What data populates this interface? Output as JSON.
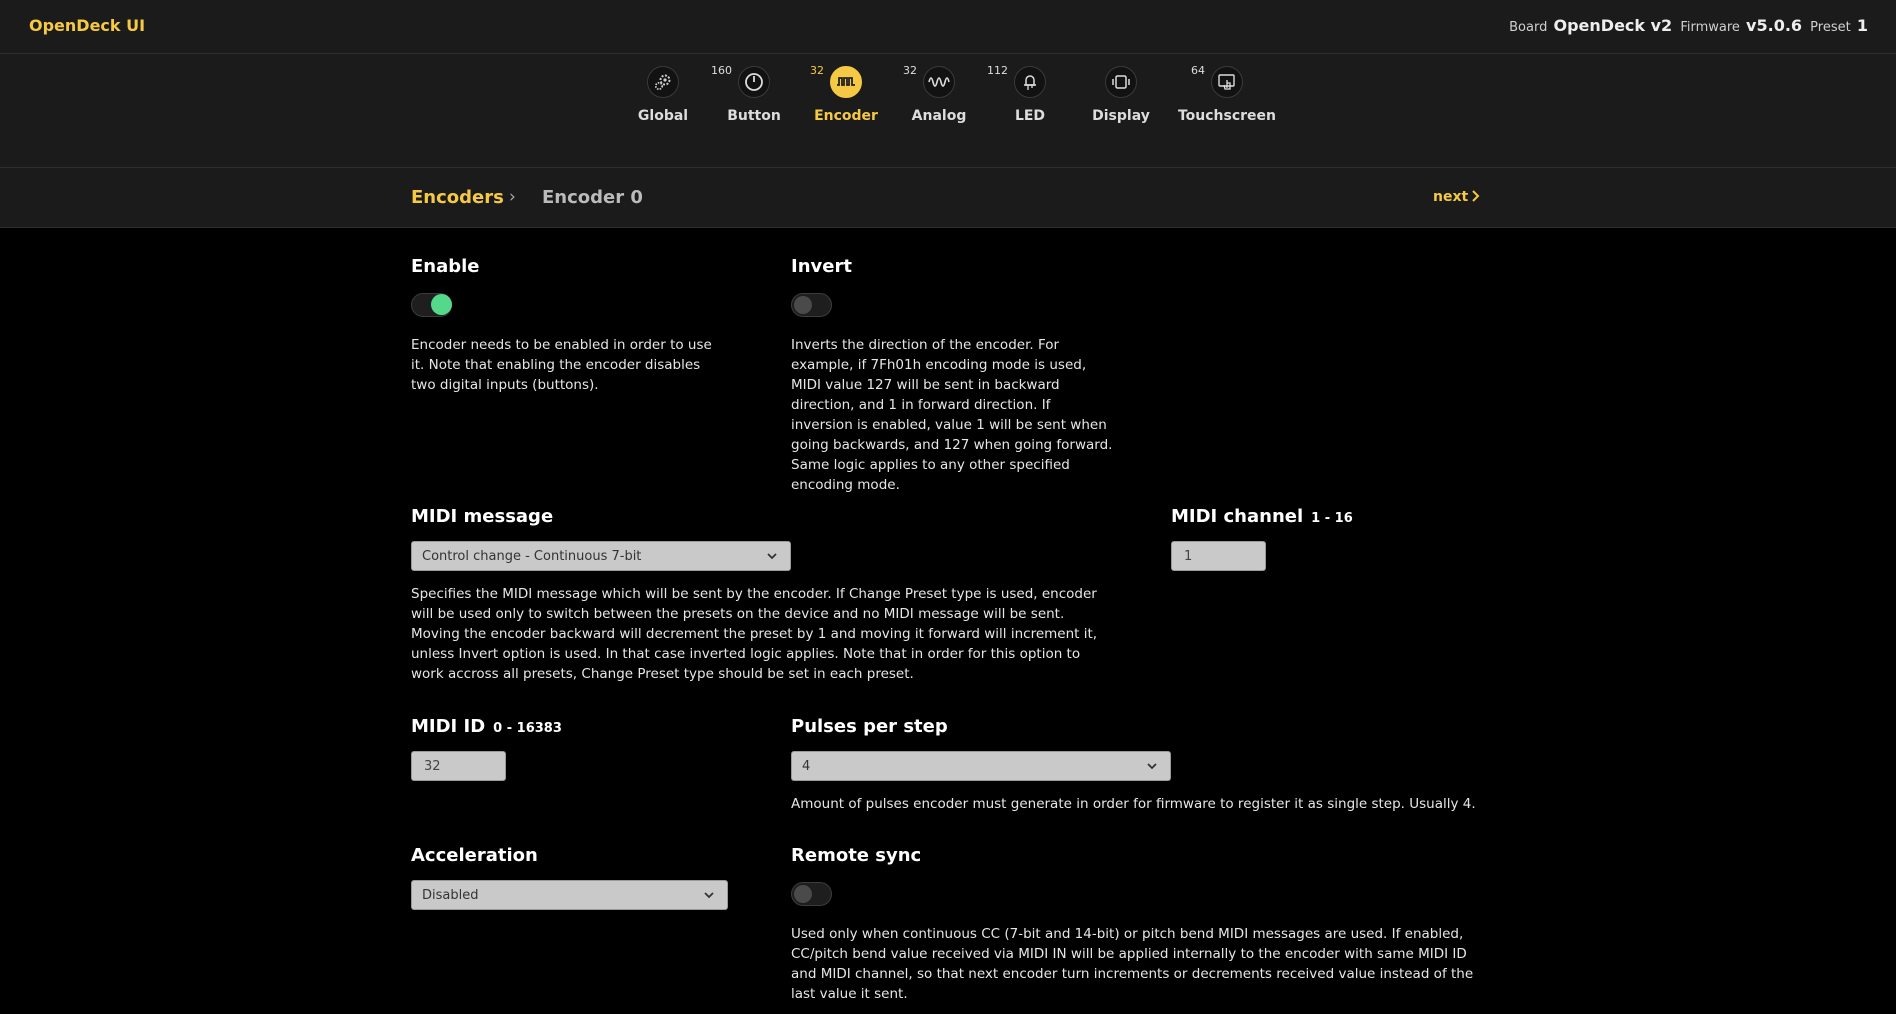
{
  "header": {
    "app_title": "OpenDeck UI",
    "board_label": "Board",
    "board_value": "OpenDeck v2",
    "firmware_label": "Firmware",
    "firmware_value": "v5.0.6",
    "preset_label": "Preset",
    "preset_value": "1"
  },
  "nav": {
    "global": {
      "label": "Global",
      "icon": "gears-icon"
    },
    "button": {
      "label": "Button",
      "count": "160",
      "icon": "power-button-icon"
    },
    "encoder": {
      "label": "Encoder",
      "count": "32",
      "icon": "encoder-pulse-icon"
    },
    "analog": {
      "label": "Analog",
      "count": "32",
      "icon": "wave-icon"
    },
    "led": {
      "label": "LED",
      "count": "112",
      "icon": "led-icon"
    },
    "display": {
      "label": "Display",
      "icon": "display-icon"
    },
    "touchscreen": {
      "label": "Touchscreen",
      "count": "64",
      "icon": "touch-hand-icon"
    }
  },
  "breadcrumb": {
    "root": "Encoders",
    "separator": "›",
    "current": "Encoder 0",
    "next_label": "next"
  },
  "settings": {
    "enable": {
      "label": "Enable",
      "on": true,
      "description": "Encoder needs to be enabled in order to use it. Note that enabling the encoder disables two digital inputs (buttons)."
    },
    "invert": {
      "label": "Invert",
      "on": false,
      "description": "Inverts the direction of the encoder. For example, if 7Fh01h encoding mode is used, MIDI value 127 will be sent in backward direction, and 1 in forward direction. If inversion is enabled, value 1 will be sent when going backwards, and 127 when going forward. Same logic applies to any other specified encoding mode."
    },
    "midi_message": {
      "label": "MIDI message",
      "selected": "Control change - Continuous 7-bit",
      "description": "Specifies the MIDI message which will be sent by the encoder. If Change Preset type is used, encoder will be used only to switch between the presets on the device and no MIDI message will be sent. Moving the encoder backward will decrement the preset by 1 and moving it forward will increment it, unless Invert option is used. In that case inverted logic applies. Note that in order for this option to work accross all presets, Change Preset type should be set in each preset."
    },
    "midi_channel": {
      "label": "MIDI channel",
      "range": "1 - 16",
      "value": "1"
    },
    "midi_id": {
      "label": "MIDI ID",
      "range": "0 - 16383",
      "value": "32"
    },
    "pulses_per_step": {
      "label": "Pulses per step",
      "selected": "4",
      "description": "Amount of pulses encoder must generate in order for firmware to register it as single step. Usually 4."
    },
    "acceleration": {
      "label": "Acceleration",
      "selected": "Disabled"
    },
    "remote_sync": {
      "label": "Remote sync",
      "on": false,
      "description": "Used only when continuous CC (7-bit and 14-bit) or pitch bend MIDI messages are used. If enabled, CC/pitch bend value received via MIDI IN will be applied internally to the encoder with same MIDI ID and MIDI channel, so that next encoder turn increments or decrements received value instead of the last value it sent."
    }
  },
  "colors": {
    "accent": "#f6c944",
    "toggle_on": "#55d88a",
    "bar_bg": "#1b1b1b",
    "page_bg": "#000000"
  }
}
